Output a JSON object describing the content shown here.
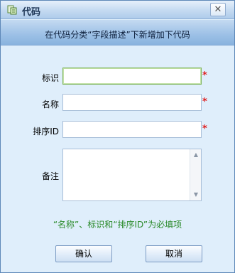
{
  "window": {
    "title": "代码",
    "close_label": "✕"
  },
  "banner": {
    "text": "在代码分类“字段描述”下新增加下代码"
  },
  "form": {
    "id_label": "标识",
    "id_value": "",
    "name_label": "名称",
    "name_value": "",
    "order_label": "排序ID",
    "order_value": "",
    "remark_label": "备注",
    "remark_value": "",
    "required_mark": "*"
  },
  "hint": "“名称”、标识和“排序ID”为必填项",
  "buttons": {
    "confirm": "确认",
    "cancel": "取消"
  },
  "colors": {
    "hint": "#2a8a2a",
    "required": "#e02020",
    "focus_border": "#7fb45a"
  }
}
